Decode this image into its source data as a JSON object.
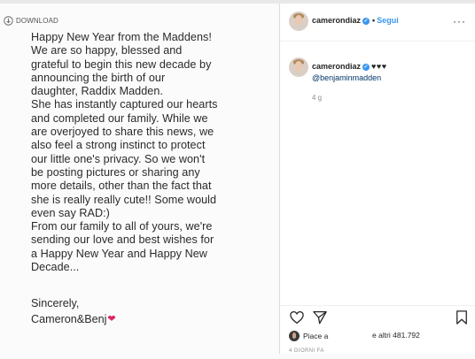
{
  "post": {
    "download_label": "DOWNLOAD",
    "announcement": "Happy New Year from the Maddens!\nWe are so happy, blessed and\ngrateful to begin this new decade by\nannouncing the birth of our\ndaughter, Raddix Madden.\nShe has instantly captured our hearts\nand completed our family. While we\nare overjoyed to share this news, we\nalso feel a strong instinct to protect\nour little one's privacy. So we won't\nbe posting pictures or sharing any\nmore details, other than the fact that\nshe is really really cute!! Some would\neven say RAD:)\nFrom our family to all of yours, we're\nsending our love and best wishes for\na Happy New Year and Happy New\nDecade...",
    "signoff": "Sincerely,",
    "signature": "Cameron&Benj",
    "signature_heart": "❤"
  },
  "header": {
    "username": "camerondiaz",
    "separator": "•",
    "follow_label": "Segui",
    "more_label": "···"
  },
  "caption": {
    "username": "camerondiaz",
    "hearts": "♥♥♥",
    "mention": "@benjaminmadden",
    "age": "4 g"
  },
  "actions": {
    "liked_by_prefix": "Piace a",
    "liked_by_suffix": "e altri 481.792",
    "date": "4 GIORNI FA"
  },
  "icons": {
    "download": "download-icon",
    "verified": "verified-badge-icon",
    "like": "heart-icon",
    "share": "send-icon",
    "save": "bookmark-icon"
  },
  "colors": {
    "link_blue": "#3897f0",
    "mention_blue": "#003569",
    "heart_red": "#e0245e"
  }
}
